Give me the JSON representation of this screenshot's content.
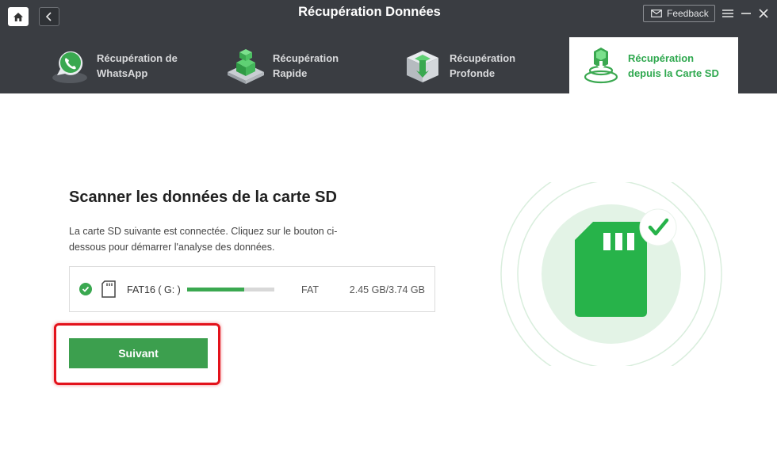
{
  "window": {
    "title": "Récupération Données",
    "feedback_label": "Feedback"
  },
  "tabs": [
    {
      "line1": "Récupération de",
      "line2": "WhatsApp",
      "icon": "whatsapp-phone-icon",
      "active": false
    },
    {
      "line1": "Récupération",
      "line2": "Rapide",
      "icon": "quick-recovery-icon",
      "active": false
    },
    {
      "line1": "Récupération",
      "line2": "Profonde",
      "icon": "deep-recovery-icon",
      "active": false
    },
    {
      "line1": "Récupération",
      "line2": "depuis la Carte SD",
      "icon": "sd-card-recovery-icon",
      "active": true
    }
  ],
  "main": {
    "title": "Scanner les données de la carte SD",
    "description": "La carte SD suivante est connectée. Cliquez sur le bouton ci-dessous pour démarrer l'analyse des données.",
    "drive": {
      "name": "FAT16 ( G: )",
      "filesystem": "FAT",
      "size": "2.45 GB/3.74 GB",
      "used_fraction": 0.65,
      "selected": true
    },
    "next_label": "Suivant"
  },
  "colors": {
    "header_bg": "#3a3d42",
    "accent_green": "#3c9f4e",
    "highlight_red": "#e3121b"
  }
}
